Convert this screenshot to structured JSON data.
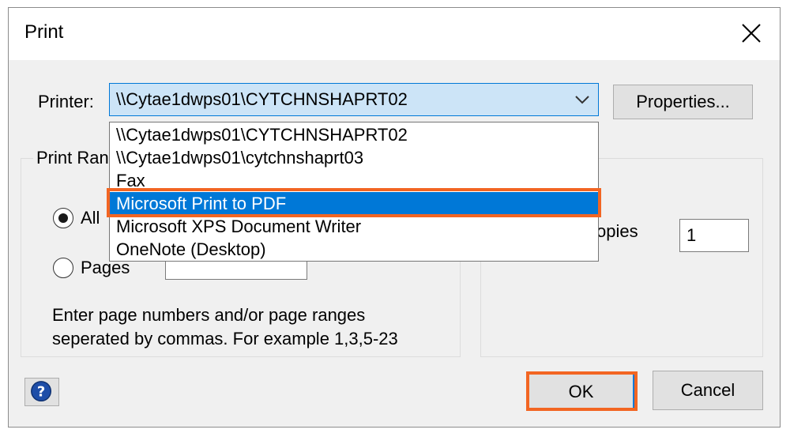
{
  "window": {
    "title": "Print",
    "close_icon": "close-icon"
  },
  "printer": {
    "label": "Printer:",
    "selected": "\\\\Cytae1dwps01\\CYTCHNSHAPRT02",
    "properties_label": "Properties...",
    "options": [
      "\\\\Cytae1dwps01\\CYTCHNSHAPRT02",
      "\\\\Cytae1dwps01\\cytchnshaprt03",
      "Fax",
      "Microsoft Print to PDF",
      "Microsoft XPS Document Writer",
      "OneNote (Desktop)"
    ],
    "highlighted_option": "Microsoft Print to PDF"
  },
  "print_range": {
    "title": "Print Ran",
    "all_label": "All",
    "pages_label": "Pages",
    "pages_value": "",
    "hint_line1": "Enter page numbers and/or page ranges",
    "hint_line2": "seperated by commas. For example 1,3,5-23"
  },
  "copies": {
    "label_partial": "opies",
    "value": "1"
  },
  "buttons": {
    "ok": "OK",
    "cancel": "Cancel",
    "help_icon": "help-icon"
  },
  "colors": {
    "accent": "#0078d7",
    "highlight": "#f26522",
    "dialog_bg": "#f0f0f0"
  }
}
